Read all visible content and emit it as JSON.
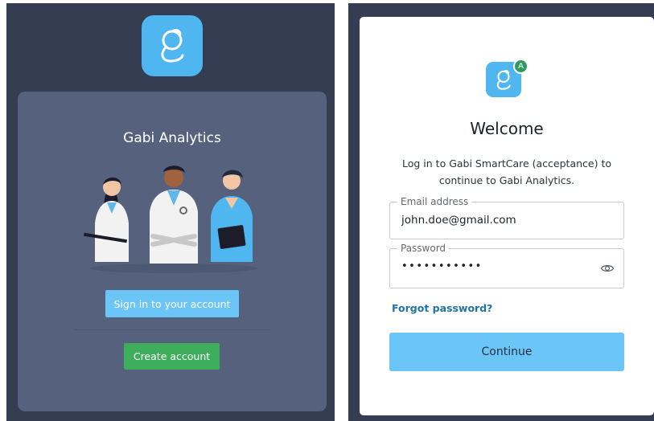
{
  "left": {
    "app_title": "Gabi Analytics",
    "signin_button": "Sign in to your account",
    "create_button": "Create account"
  },
  "right": {
    "badge_letter": "A",
    "welcome": "Welcome",
    "subtitle": "Log in to Gabi SmartCare (acceptance) to continue to Gabi Analytics.",
    "email_label": "Email address",
    "email_value": "john.doe@gmail.com",
    "password_label": "Password",
    "password_masked": "•••••••••••",
    "forgot_link": "Forgot password?",
    "continue_button": "Continue"
  },
  "colors": {
    "brand_blue": "#4fb6ef",
    "primary_button": "#6cc5f7",
    "create_green": "#3fae5c",
    "dark_background": "#343d52",
    "card_background": "#56627d",
    "link_blue": "#1f73a8"
  },
  "icons": {
    "logo": "gabi-logo-icon",
    "password_toggle": "eye-icon"
  }
}
